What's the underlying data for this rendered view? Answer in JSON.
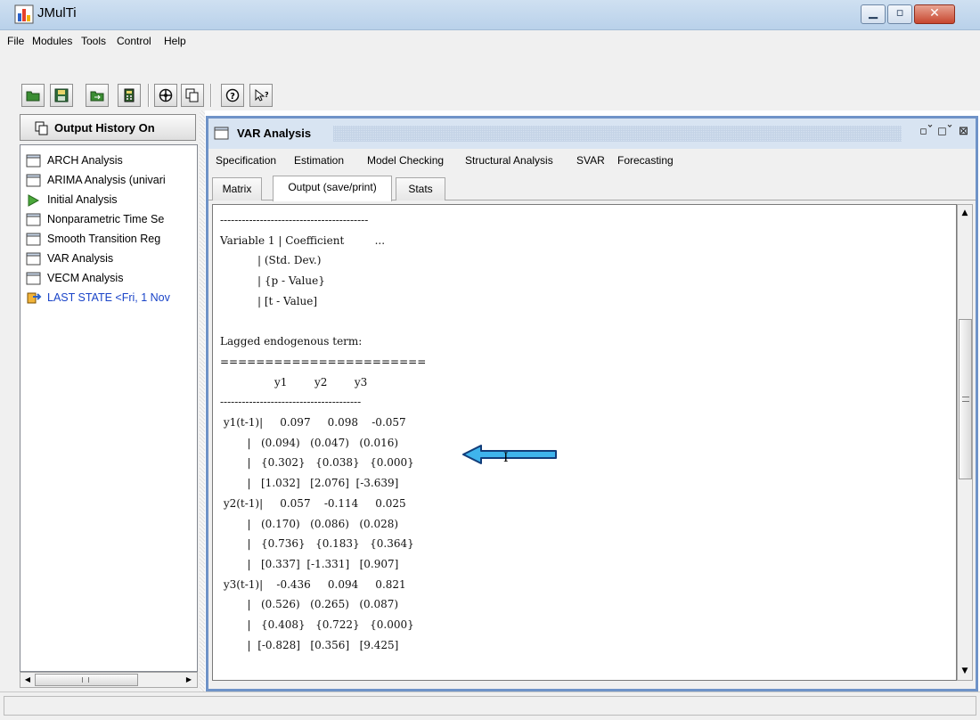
{
  "window": {
    "title": "JMulTi"
  },
  "menubar": {
    "items": [
      "File",
      "Modules",
      "Tools",
      "Control",
      "Help"
    ]
  },
  "toolbar": {
    "buttons": [
      "open-folder-icon",
      "save-icon",
      "import-icon",
      "calculator-icon",
      "target-icon",
      "copy-icon",
      "help-icon",
      "context-help-icon"
    ]
  },
  "history": {
    "toggle_label": "Output History On",
    "items": [
      {
        "label": "ARCH Analysis",
        "icon": "window-icon"
      },
      {
        "label": "ARIMA Analysis (univari",
        "icon": "window-icon"
      },
      {
        "label": "Initial Analysis",
        "icon": "play-icon"
      },
      {
        "label": "Nonparametric Time Se",
        "icon": "window-icon"
      },
      {
        "label": "Smooth Transition Reg",
        "icon": "window-icon"
      },
      {
        "label": "VAR Analysis",
        "icon": "window-icon"
      },
      {
        "label": "VECM Analysis",
        "icon": "window-icon"
      },
      {
        "label": "LAST STATE <Fri, 1 Nov",
        "icon": "state-icon"
      }
    ]
  },
  "inner_window": {
    "title": "VAR Analysis",
    "menu": [
      "Specification",
      "Estimation",
      "Model Checking",
      "Structural Analysis",
      "SVAR",
      "Forecasting"
    ],
    "tabs": [
      "Matrix",
      "Output (save/print)",
      "Stats"
    ],
    "active_tab": "Output (save/print)"
  },
  "output": {
    "text": "-----------------------------------------\nVariable 1 | Coefficient         ...\n           | (Std. Dev.)\n           | {p - Value}\n           | [t - Value]\n\nLagged endogenous term:\n=======================\n                y1        y2        y3\n---------------------------------------\n y1(t-1)|     0.097     0.098    -0.057\n        |   (0.094)   (0.047)   (0.016)\n        |   {0.302}   {0.038}   {0.000}\n        |   [1.032]   [2.076]  [-3.639]\n y2(t-1)|     0.057    -0.114     0.025\n        |   (0.170)   (0.086)   (0.028)\n        |   {0.736}   {0.183}   {0.364}\n        |   [0.337]  [-1.331]   [0.907]\n y3(t-1)|    -0.436     0.094     0.821\n        |   (0.526)   (0.265)   (0.087)\n        |   {0.408}   {0.722}   {0.000}\n        |  [-0.828]   [0.356]   [9.425]"
  },
  "colors": {
    "titlebar": "#c7daf0",
    "inner_border": "#6f93c8",
    "arrow": "#3fb4ec",
    "last_state": "#1a44c8"
  }
}
